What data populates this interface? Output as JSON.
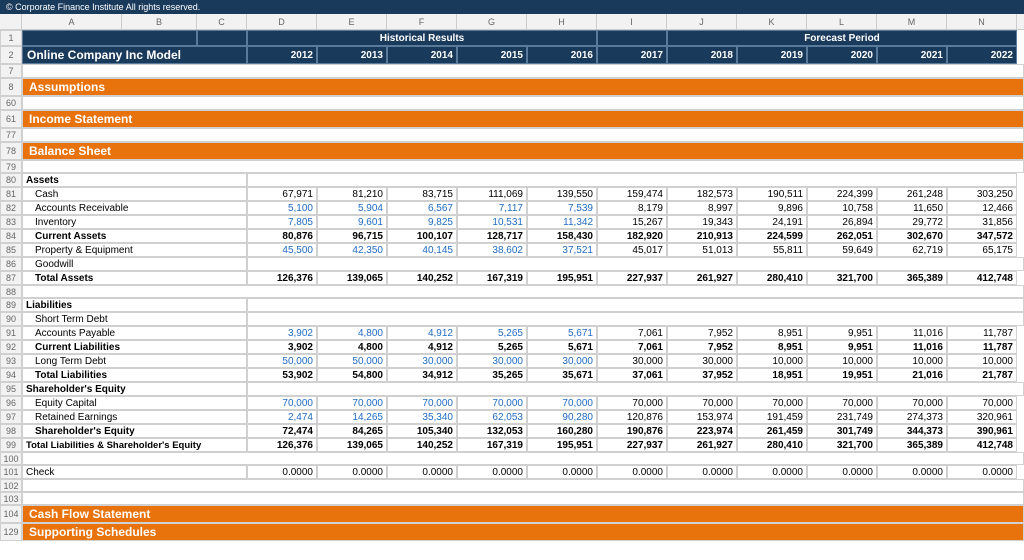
{
  "topBar": {
    "text": "© Corporate Finance Institute   All rights reserved."
  },
  "colHeaders": [
    "",
    "A",
    "B",
    "C",
    "D",
    "E",
    "F",
    "G",
    "H",
    "I",
    "J",
    "K",
    "L",
    "M",
    "N"
  ],
  "rows": [
    {
      "rowNum": "1",
      "type": "top-bar",
      "cells": [
        "",
        "",
        "",
        "",
        "",
        "",
        "",
        "",
        "",
        "",
        "",
        "",
        "",
        "",
        ""
      ]
    },
    {
      "rowNum": "2",
      "type": "company-header",
      "cells": [
        "Online Company Inc Model",
        "",
        "",
        "2012",
        "2013",
        "2014",
        "2015",
        "2016",
        "2017",
        "2018",
        "2019",
        "2020",
        "2021",
        "2022"
      ]
    },
    {
      "rowNum": "7",
      "type": "empty"
    },
    {
      "rowNum": "8",
      "type": "section",
      "label": "Assumptions"
    },
    {
      "rowNum": "60",
      "type": "empty"
    },
    {
      "rowNum": "61",
      "type": "section",
      "label": "Income Statement"
    },
    {
      "rowNum": "77",
      "type": "empty"
    },
    {
      "rowNum": "78",
      "type": "section",
      "label": "Balance Sheet"
    },
    {
      "rowNum": "79",
      "type": "empty"
    },
    {
      "rowNum": "80",
      "type": "label-bold",
      "label": "Assets"
    },
    {
      "rowNum": "81",
      "type": "data",
      "label": "Cash",
      "d": "67,971",
      "e": "81,210",
      "f": "83,715",
      "g": "111,069",
      "h": "139,550",
      "i": "159,474",
      "j": "182,573",
      "k": "190,511",
      "l": "224,399",
      "m": "261,248",
      "n": "303,250",
      "style": "normal"
    },
    {
      "rowNum": "82",
      "type": "data",
      "label": "Accounts Receivable",
      "d": "5,100",
      "e": "5,904",
      "f": "6,567",
      "g": "7,117",
      "h": "7,539",
      "i": "8,179",
      "j": "8,997",
      "k": "9,896",
      "l": "10,758",
      "m": "11,650",
      "n": "12,466",
      "style": "blue"
    },
    {
      "rowNum": "83",
      "type": "data",
      "label": "Inventory",
      "d": "7,805",
      "e": "9,601",
      "f": "9,825",
      "g": "10,531",
      "h": "11,342",
      "i": "15,267",
      "j": "19,343",
      "k": "24,191",
      "l": "26,894",
      "m": "29,772",
      "n": "31,856",
      "style": "blue"
    },
    {
      "rowNum": "84",
      "type": "data-bold",
      "label": "Current Assets",
      "d": "80,876",
      "e": "96,715",
      "f": "100,107",
      "g": "128,717",
      "h": "158,430",
      "i": "182,920",
      "j": "210,913",
      "k": "224,599",
      "l": "262,051",
      "m": "302,670",
      "n": "347,572"
    },
    {
      "rowNum": "85",
      "type": "data",
      "label": "Property & Equipment",
      "d": "45,500",
      "e": "42,350",
      "f": "40,145",
      "g": "38,602",
      "h": "37,521",
      "i": "45,017",
      "j": "51,013",
      "k": "55,811",
      "l": "59,649",
      "m": "62,719",
      "n": "65,175",
      "style": "blue"
    },
    {
      "rowNum": "86",
      "type": "data",
      "label": "Goodwill",
      "d": "",
      "e": "",
      "f": "",
      "g": "",
      "h": "",
      "i": "",
      "j": "",
      "k": "",
      "l": "",
      "m": "",
      "n": "",
      "style": "normal"
    },
    {
      "rowNum": "87",
      "type": "data-bold",
      "label": "Total Assets",
      "d": "126,376",
      "e": "139,065",
      "f": "140,252",
      "g": "167,319",
      "h": "195,951",
      "i": "227,937",
      "j": "261,927",
      "k": "280,410",
      "l": "321,700",
      "m": "365,389",
      "n": "412,748"
    },
    {
      "rowNum": "88",
      "type": "empty"
    },
    {
      "rowNum": "89",
      "type": "label-bold",
      "label": "Liabilities"
    },
    {
      "rowNum": "90",
      "type": "data",
      "label": "Short Term Debt",
      "d": "",
      "e": "",
      "f": "",
      "g": "",
      "h": "",
      "i": "",
      "j": "",
      "k": "",
      "l": "",
      "m": "",
      "n": "",
      "style": "normal"
    },
    {
      "rowNum": "91",
      "type": "data",
      "label": "Accounts Payable",
      "d": "3,902",
      "e": "4,800",
      "f": "4,912",
      "g": "5,265",
      "h": "5,671",
      "i": "7,061",
      "j": "7,952",
      "k": "8,951",
      "l": "9,951",
      "m": "11,016",
      "n": "11,787",
      "style": "blue"
    },
    {
      "rowNum": "92",
      "type": "data-bold",
      "label": "Current Liabilities",
      "d": "3,902",
      "e": "4,800",
      "f": "4,912",
      "g": "5,265",
      "h": "5,671",
      "i": "7,061",
      "j": "7,952",
      "k": "8,951",
      "l": "9,951",
      "m": "11,016",
      "n": "11,787"
    },
    {
      "rowNum": "93",
      "type": "data",
      "label": "Long Term Debt",
      "d": "50,000",
      "e": "50,000",
      "f": "30,000",
      "g": "30,000",
      "h": "30,000",
      "i": "30,000",
      "j": "30,000",
      "k": "10,000",
      "l": "10,000",
      "m": "10,000",
      "n": "10,000",
      "style": "blue"
    },
    {
      "rowNum": "94",
      "type": "data-bold",
      "label": "Total Liabilities",
      "d": "53,902",
      "e": "54,800",
      "f": "34,912",
      "g": "35,265",
      "h": "35,671",
      "i": "37,061",
      "j": "37,952",
      "k": "18,951",
      "l": "19,951",
      "m": "21,016",
      "n": "21,787"
    },
    {
      "rowNum": "95",
      "type": "label-bold",
      "label": "Shareholder's Equity"
    },
    {
      "rowNum": "96",
      "type": "data",
      "label": "Equity Capital",
      "d": "70,000",
      "e": "70,000",
      "f": "70,000",
      "g": "70,000",
      "h": "70,000",
      "i": "70,000",
      "j": "70,000",
      "k": "70,000",
      "l": "70,000",
      "m": "70,000",
      "n": "70,000",
      "style": "blue"
    },
    {
      "rowNum": "97",
      "type": "data",
      "label": "Retained Earnings",
      "d": "2,474",
      "e": "14,265",
      "f": "35,340",
      "g": "62,053",
      "h": "90,280",
      "i": "120,876",
      "j": "153,974",
      "k": "191,459",
      "l": "231,749",
      "m": "274,373",
      "n": "320,961",
      "style": "blue"
    },
    {
      "rowNum": "98",
      "type": "data-bold",
      "label": "Shareholder's Equity",
      "d": "72,474",
      "e": "84,265",
      "f": "105,340",
      "g": "132,053",
      "h": "160,280",
      "i": "190,876",
      "j": "223,974",
      "k": "261,459",
      "l": "301,749",
      "m": "344,373",
      "n": "390,961"
    },
    {
      "rowNum": "99",
      "type": "data-bold",
      "label": "Total Liabilities & Shareholder's Equity",
      "d": "126,376",
      "e": "139,065",
      "f": "140,252",
      "g": "167,319",
      "h": "195,951",
      "i": "227,937",
      "j": "261,927",
      "k": "280,410",
      "l": "321,700",
      "m": "365,389",
      "n": "412,748"
    },
    {
      "rowNum": "100",
      "type": "empty"
    },
    {
      "rowNum": "101",
      "type": "data",
      "label": "Check",
      "d": "0.0000",
      "e": "0.0000",
      "f": "0.0000",
      "g": "0.0000",
      "h": "0.0000",
      "i": "0.0000",
      "j": "0.0000",
      "k": "0.0000",
      "l": "0.0000",
      "m": "0.0000",
      "n": "0.0000",
      "style": "normal"
    },
    {
      "rowNum": "102",
      "type": "empty"
    },
    {
      "rowNum": "103",
      "type": "empty"
    },
    {
      "rowNum": "104",
      "type": "section",
      "label": "Cash Flow Statement"
    },
    {
      "rowNum": "129",
      "type": "section",
      "label": "Supporting Schedules"
    }
  ],
  "histLabel": "Historical Results",
  "forecastLabel": "Forecast Period"
}
